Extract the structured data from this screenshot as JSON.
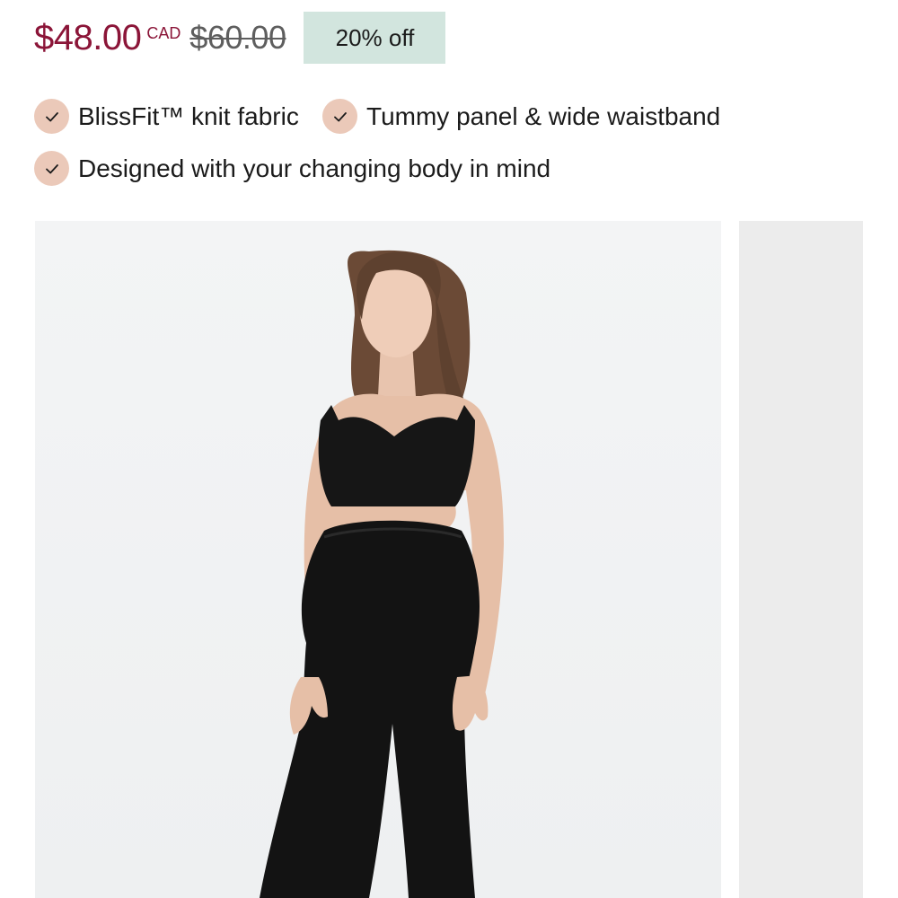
{
  "price": {
    "current": "$48.00",
    "currency": "CAD",
    "original": "$60.00",
    "discount": "20% off",
    "color": "#8b1538",
    "badge_color": "#d2e5de"
  },
  "features": [
    {
      "label": "BlissFit™ knit fabric",
      "icon": "check-icon"
    },
    {
      "label": "Tummy panel & wide waistband",
      "icon": "check-icon"
    },
    {
      "label": "Designed with your changing body in mind",
      "icon": "check-icon"
    }
  ],
  "feature_icon_bg": "#ebc9b9",
  "gallery": {
    "images": [
      {
        "name": "product-image-main"
      },
      {
        "name": "product-image-next"
      }
    ]
  }
}
